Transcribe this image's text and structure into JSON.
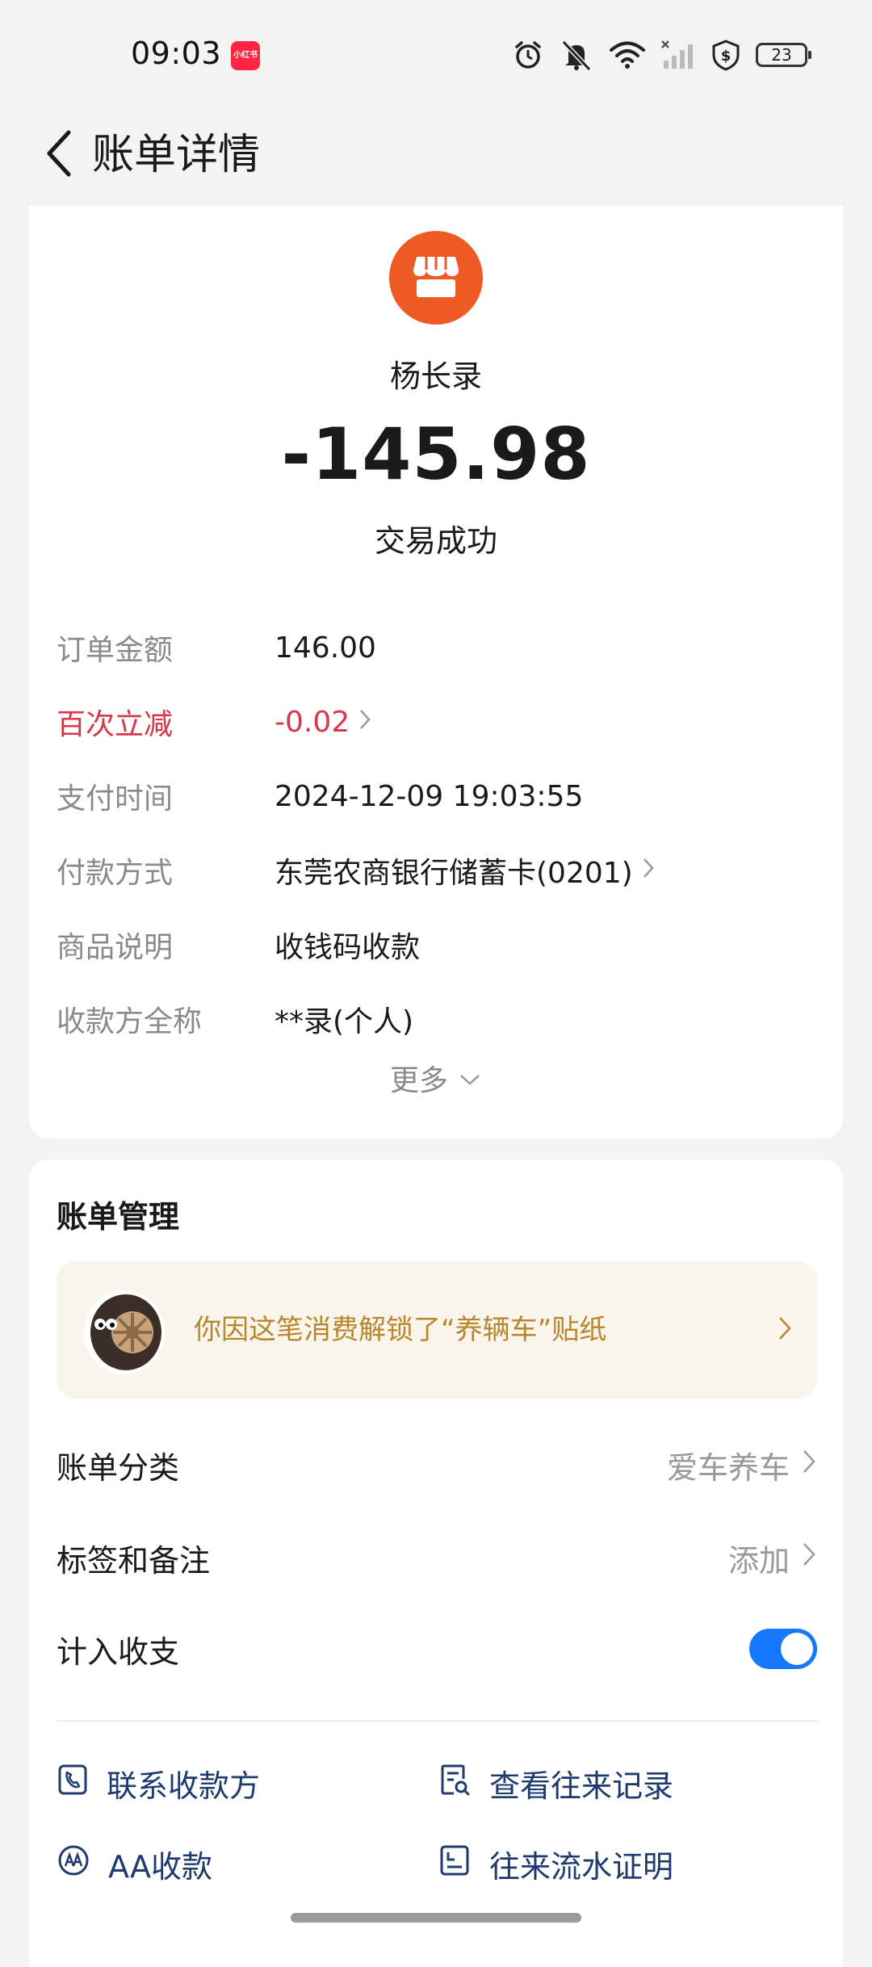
{
  "status_bar": {
    "time": "09:03",
    "app_badge": "小红书",
    "battery": "23"
  },
  "header": {
    "title": "账单详情"
  },
  "merchant": {
    "name": "杨长录",
    "amount": "-145.98",
    "status": "交易成功"
  },
  "details": [
    {
      "label": "订单金额",
      "value": "146.00"
    },
    {
      "label": "百次立减",
      "value": "-0.02"
    },
    {
      "label": "支付时间",
      "value": "2024-12-09 19:03:55"
    },
    {
      "label": "付款方式",
      "value": "东莞农商银行储蓄卡(0201)"
    },
    {
      "label": "商品说明",
      "value": "收钱码收款"
    },
    {
      "label": "收款方全称",
      "value": "**录(个人)"
    }
  ],
  "more_label": "更多",
  "manage": {
    "title": "账单管理",
    "sticker_text": "你因这笔消费解锁了“养辆车”贴纸",
    "category_label": "账单分类",
    "category_value": "爱车养车",
    "tags_label": "标签和备注",
    "tags_value": "添加",
    "include_label": "计入收支",
    "include_enabled": true,
    "actions": [
      {
        "label": "联系收款方",
        "icon": "phone-icon"
      },
      {
        "label": "查看往来记录",
        "icon": "records-icon"
      },
      {
        "label": "AA收款",
        "icon": "aa-icon"
      },
      {
        "label": "往来流水证明",
        "icon": "certificate-icon"
      }
    ]
  },
  "colors": {
    "accent": "#1677ff",
    "discount": "#d9374a",
    "merchant_avatar": "#ee5a24",
    "sticker_text": "#b8862b",
    "action_text": "#1f3a6e"
  }
}
